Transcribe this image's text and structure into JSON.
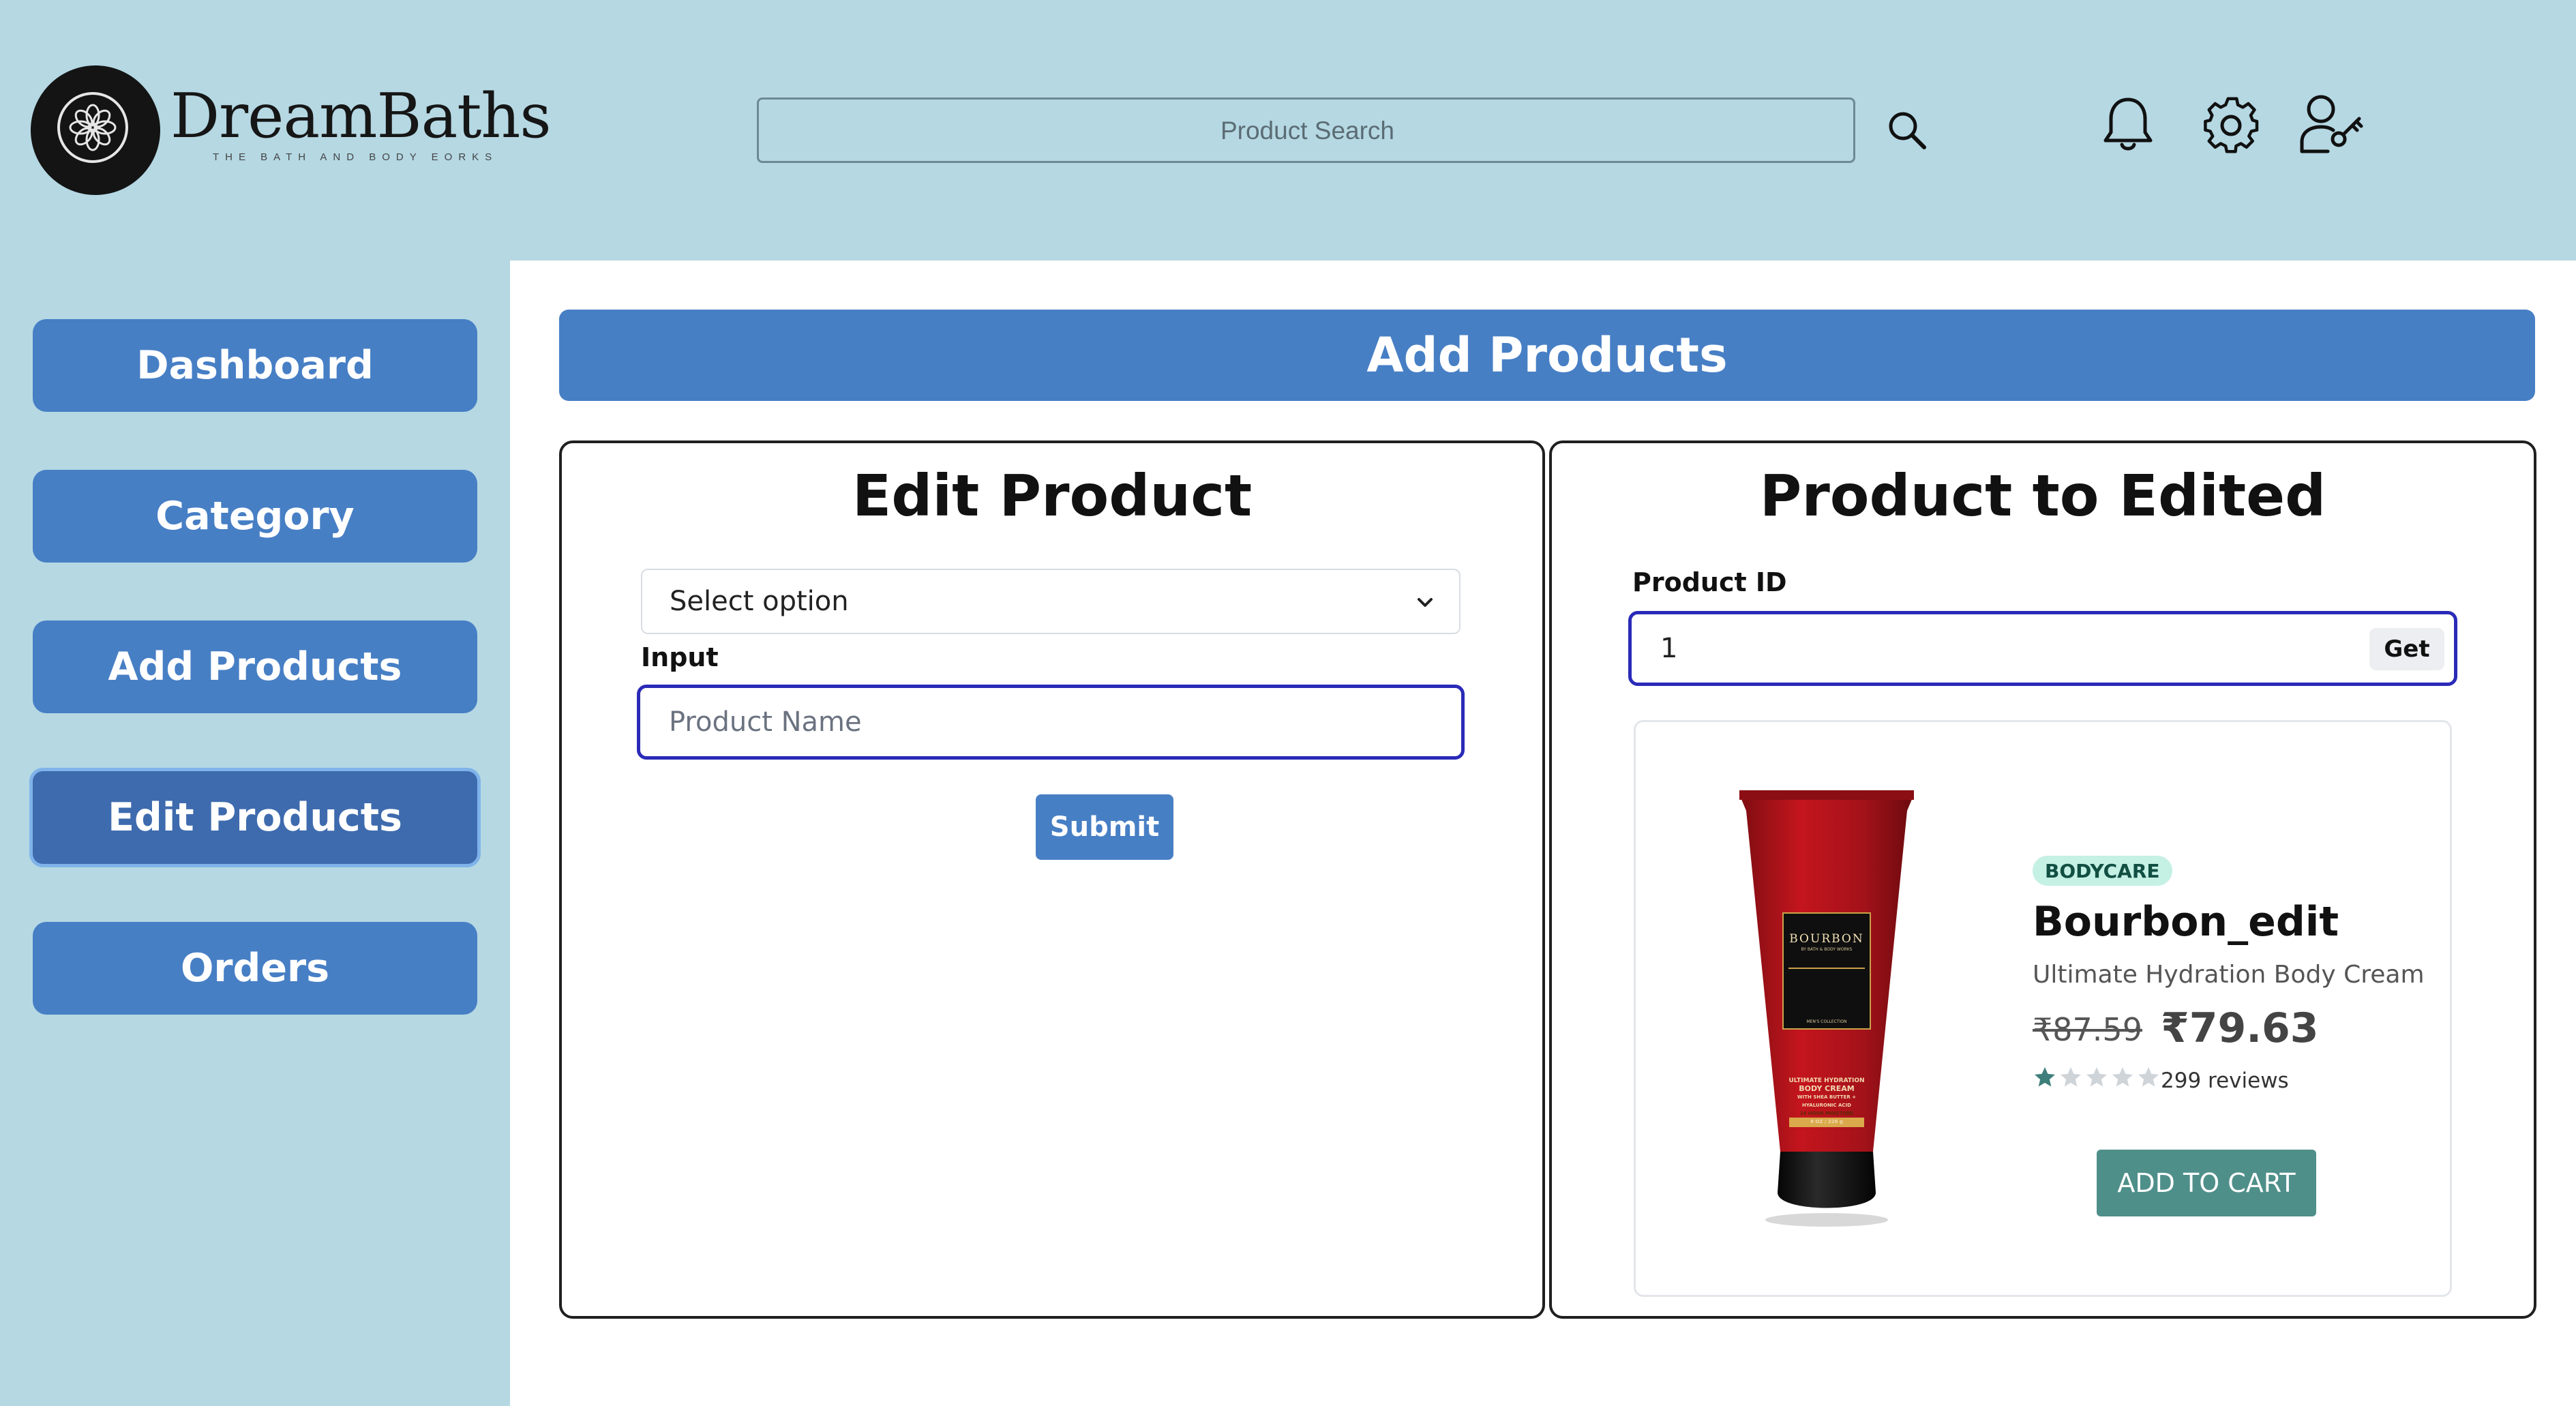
{
  "brand": {
    "name": "DreamBaths",
    "tagline": "THE BATH AND BODY EORKS"
  },
  "search": {
    "placeholder": "Product Search"
  },
  "header_icons": [
    "search-icon",
    "bell-icon",
    "gear-icon",
    "user-key-icon"
  ],
  "sidebar": {
    "items": [
      {
        "label": "Dashboard",
        "active": false
      },
      {
        "label": "Category",
        "active": false
      },
      {
        "label": "Add Products",
        "active": false
      },
      {
        "label": "Edit Products",
        "active": true
      },
      {
        "label": "Orders",
        "active": false
      }
    ]
  },
  "main": {
    "title": "Add Products"
  },
  "edit_panel": {
    "title": "Edit Product",
    "select_value": "Select option",
    "input_label": "Input",
    "input_placeholder": "Product Name",
    "submit_label": "Submit"
  },
  "preview_panel": {
    "title": "Product to Edited",
    "product_id_label": "Product ID",
    "product_id_value": "1",
    "get_label": "Get"
  },
  "product": {
    "category": "BODYCARE",
    "name": "Bourbon_edit",
    "description": "Ultimate Hydration Body Cream",
    "old_price": "₹87.59",
    "price": "₹79.63",
    "rating": 1,
    "rating_max": 5,
    "reviews": "299 reviews",
    "cart_label": "ADD TO CART",
    "tube_brand": "BOURBON",
    "tube_sub": "BY BATH & BODY WORKS",
    "tube_collection": "MEN'S COLLECTION",
    "tube_lines": [
      "ULTIMATE HYDRATION",
      "BODY CREAM",
      "WITH SHEA BUTTER +",
      "HYALURONIC ACID",
      "24 HOUR MOISTURE",
      "8 OZ / 226 g"
    ]
  },
  "colors": {
    "header_bg": "#b5d8e3",
    "primary": "#477fc5",
    "active": "#3e6bae",
    "cart": "#4f8f8a",
    "badge_bg": "#c5f0e4"
  }
}
